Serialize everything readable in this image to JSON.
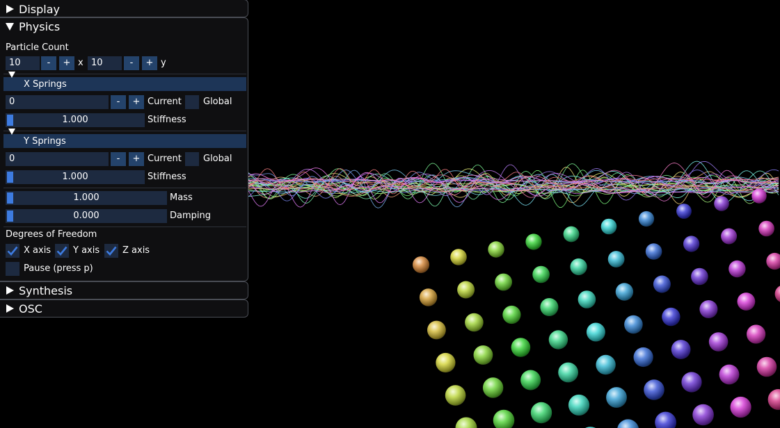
{
  "panels": {
    "display": {
      "title": "Display",
      "expanded": false
    },
    "physics": {
      "title": "Physics",
      "expanded": true,
      "particle_count": {
        "label": "Particle Count",
        "x_value": "10",
        "y_value": "10",
        "minus": "-",
        "plus": "+",
        "x_label": "x",
        "y_label": "y"
      },
      "x_springs": {
        "title": "X Springs",
        "current_value": "0",
        "current_label": "Current",
        "global_label": "Global",
        "global_checked": false,
        "stiffness_value": "1.000",
        "stiffness_label": "Stiffness",
        "stiffness_fraction": 0.0
      },
      "y_springs": {
        "title": "Y Springs",
        "current_value": "0",
        "current_label": "Current",
        "global_label": "Global",
        "global_checked": false,
        "stiffness_value": "1.000",
        "stiffness_label": "Stiffness",
        "stiffness_fraction": 0.0
      },
      "mass": {
        "value": "1.000",
        "label": "Mass",
        "fraction": 0.0
      },
      "damping": {
        "value": "0.000",
        "label": "Damping",
        "fraction": 0.0
      },
      "dof": {
        "label": "Degrees of Freedom",
        "x_axis": {
          "label": "X axis",
          "checked": true
        },
        "y_axis": {
          "label": "Y axis",
          "checked": true
        },
        "z_axis": {
          "label": "Z axis",
          "checked": true
        }
      },
      "pause": {
        "label": "Pause (press p)",
        "checked": false
      }
    },
    "synthesis": {
      "title": "Synthesis",
      "expanded": false
    },
    "osc": {
      "title": "OSC",
      "expanded": false
    }
  },
  "colors": {
    "background": "#000000",
    "panel_bg": "#101012",
    "frame_bg": "#1d2a40",
    "button_bg": "#24436b",
    "header_bg": "#1d3557",
    "accent": "#3d7be0"
  },
  "scene": {
    "waveform_lines": 32,
    "sphere_grid": "10x10"
  }
}
